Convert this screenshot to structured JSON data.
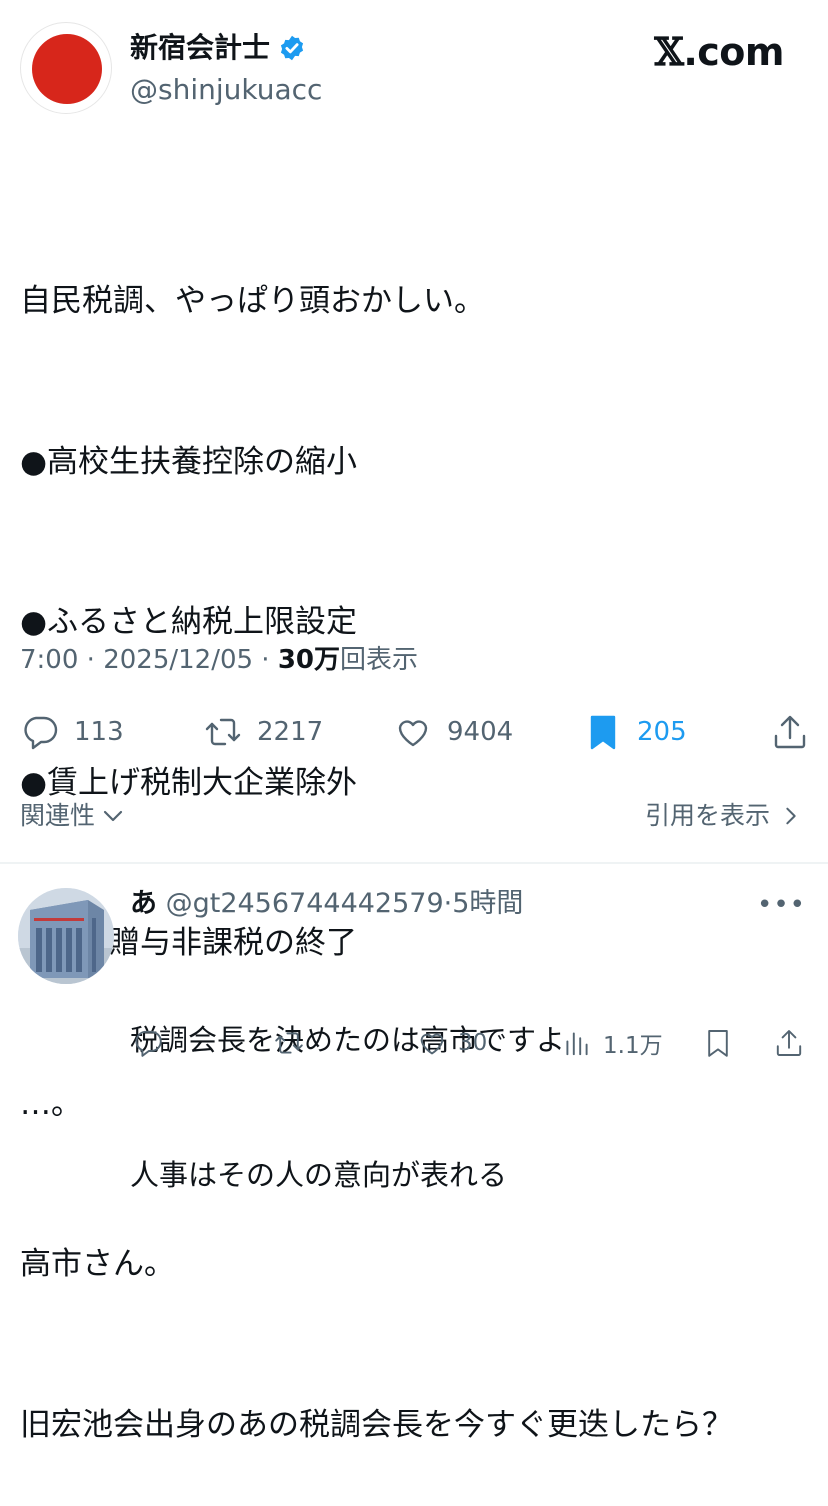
{
  "author": {
    "display_name": "新宿会計士",
    "handle": "@shinjukuacc",
    "verified": true,
    "avatar_icon": "rising-sun-flag-avatar"
  },
  "brand": {
    "x_glyph": "𝕏",
    "domain_suffix": ".com"
  },
  "post": {
    "lines": [
      "自民税調、やっぱり頭おかしい。",
      "●高校生扶養控除の縮小",
      "●ふるさと納税上限設定",
      "●賃上げ税制大企業除外",
      "●教育贈与非課税の終了",
      "…。",
      "高市さん。",
      "旧宏池会出身のあの税調会長を今すぐ更迭したら？"
    ],
    "time": "7:00",
    "date": "2025/12/05",
    "separator": " · ",
    "views_count": "30万",
    "views_label": "回表示"
  },
  "stats": {
    "replies": "113",
    "reposts": "2217",
    "likes": "9404",
    "bookmarks": "205"
  },
  "colors": {
    "accent": "#1d9bf0",
    "muted": "#536471",
    "text": "#0f1419",
    "flag_red": "#d7261b"
  },
  "links": {
    "related_label": "関連性",
    "quotes_label": "引用を表示"
  },
  "reply": {
    "name": "あ",
    "handle": "@gt2456744442579",
    "dot": "·",
    "time_ago": "5時間",
    "lines": [
      "税調会長を決めたのは高市ですよ",
      "人事はその人の意向が表れる"
    ],
    "likes": "30",
    "views": "1.1万",
    "more_glyph": "•••"
  }
}
